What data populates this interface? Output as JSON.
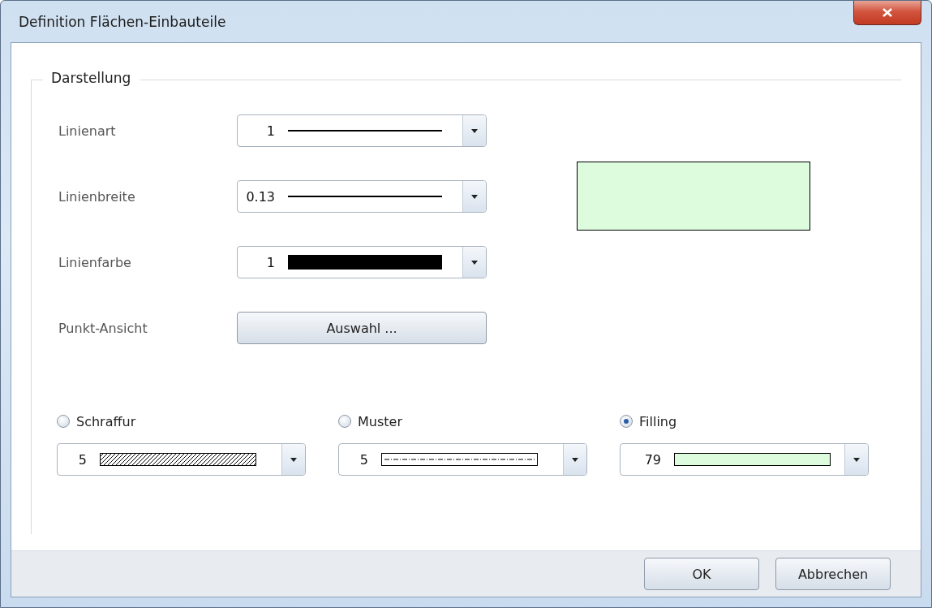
{
  "window": {
    "title": "Definition Flächen-Einbauteile"
  },
  "group": {
    "title": "Darstellung"
  },
  "rows": [
    {
      "kind": "combo",
      "label": "Linienart",
      "value": "1",
      "swatch": {
        "kind": "line"
      }
    },
    {
      "kind": "combo",
      "label": "Linienbreite",
      "value": "0.13",
      "swatch": {
        "kind": "line"
      }
    },
    {
      "kind": "combo",
      "label": "Linienfarbe",
      "value": "1",
      "swatch": {
        "kind": "bar"
      }
    },
    {
      "kind": "button",
      "label": "Punkt-Ansicht",
      "button": "Auswahl ..."
    }
  ],
  "fills": [
    {
      "label": "Schraffur",
      "selected": false,
      "value": "5",
      "swatch": {
        "kind": "hatch"
      }
    },
    {
      "label": "Muster",
      "selected": false,
      "value": "5",
      "swatch": {
        "kind": "dashes"
      }
    },
    {
      "label": "Filling",
      "selected": true,
      "value": "79",
      "swatch": {
        "kind": "fill"
      }
    }
  ],
  "buttons": [
    "OK",
    "Abbrechen"
  ]
}
